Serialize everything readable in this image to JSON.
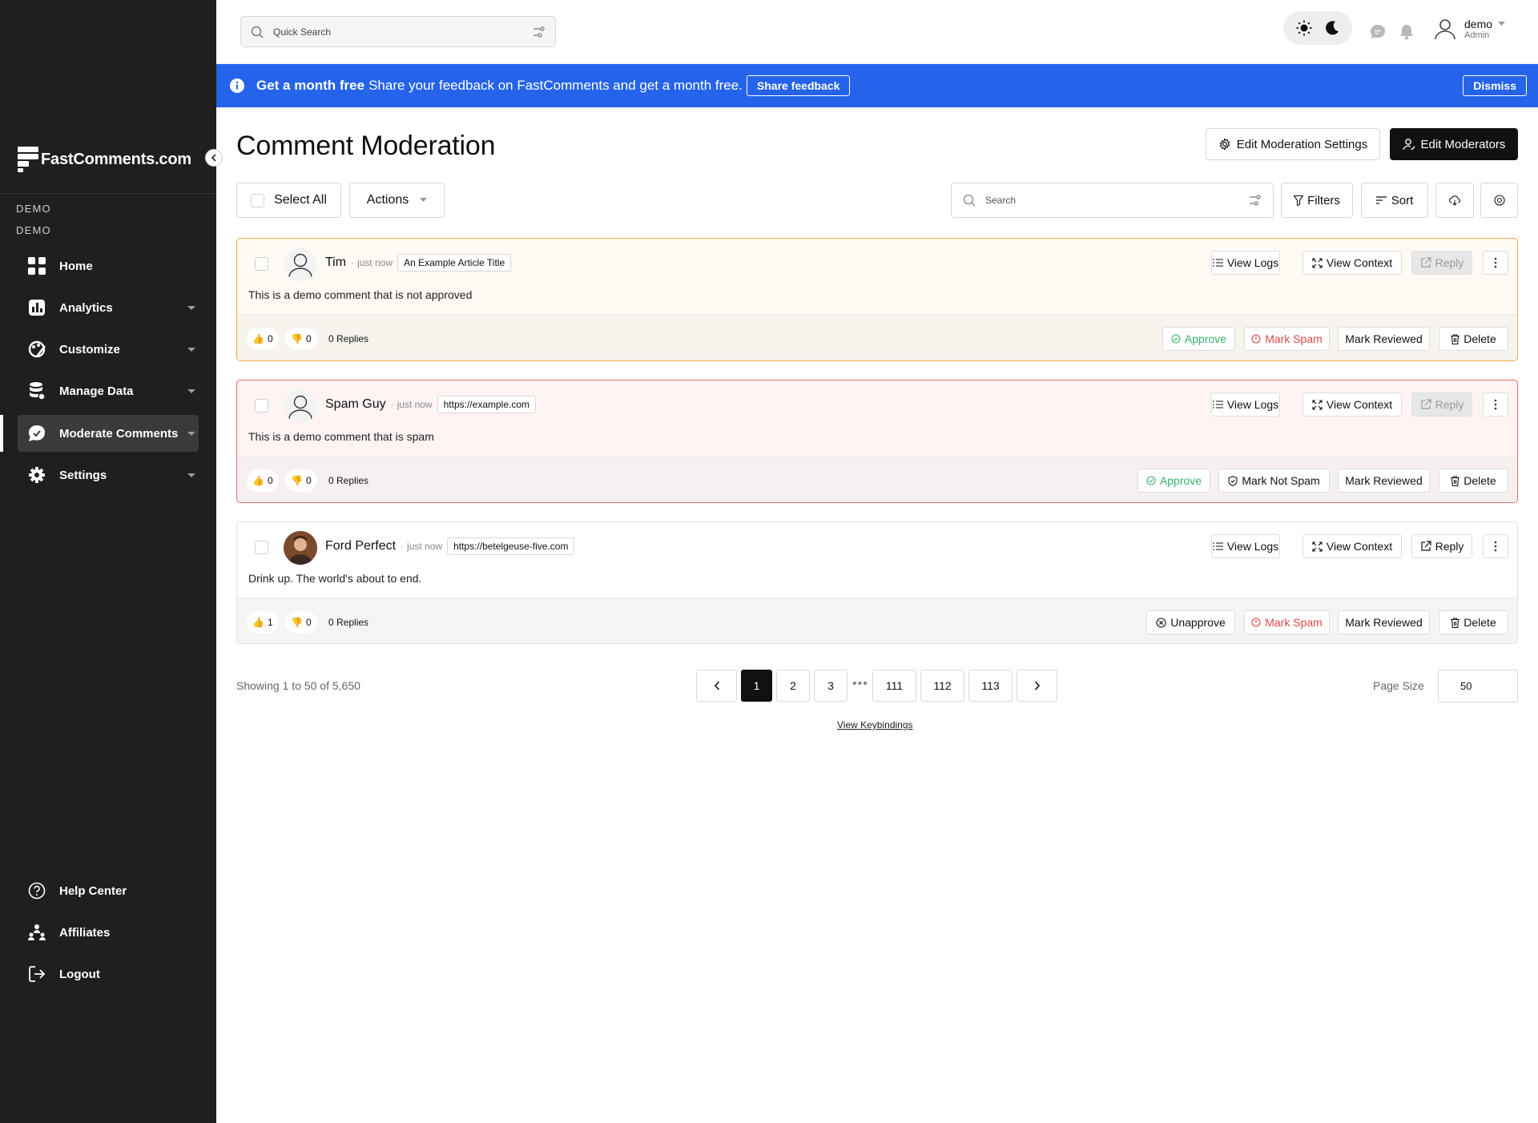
{
  "sidebar": {
    "brand": "FastComments.com",
    "org_line1": "DEMO",
    "org_line2": "DEMO",
    "items": [
      {
        "label": "Home",
        "icon": "grid-icon",
        "has_caret": false
      },
      {
        "label": "Analytics",
        "icon": "chart-icon",
        "has_caret": true
      },
      {
        "label": "Customize",
        "icon": "palette-icon",
        "has_caret": true
      },
      {
        "label": "Manage Data",
        "icon": "database-icon",
        "has_caret": true
      },
      {
        "label": "Moderate Comments",
        "icon": "chat-icon",
        "has_caret": true,
        "active": true
      },
      {
        "label": "Settings",
        "icon": "gear-icon",
        "has_caret": true
      }
    ],
    "bottom_items": [
      {
        "label": "Help Center",
        "icon": "help-circle-icon"
      },
      {
        "label": "Affiliates",
        "icon": "people-icon"
      },
      {
        "label": "Logout",
        "icon": "logout-icon"
      }
    ]
  },
  "topbar": {
    "search_placeholder": "Quick Search",
    "user_name": "demo",
    "user_role": "Admin"
  },
  "banner": {
    "bold": "Get a month free",
    "message": "Share your feedback on FastComments and get a month free.",
    "share_label": "Share feedback",
    "dismiss_label": "Dismiss",
    "color": "#2563eb"
  },
  "page": {
    "title": "Comment Moderation",
    "edit_settings_label": "Edit Moderation Settings",
    "edit_moderators_label": "Edit Moderators",
    "select_all_label": "Select All",
    "actions_label": "Actions",
    "search_placeholder": "Search",
    "filters_label": "Filters",
    "sort_label": "Sort"
  },
  "comments": [
    {
      "author": "Tim",
      "time": "just now",
      "page": "An Example Article Title",
      "text": "This is a demo comment that is not approved",
      "upvotes": "0",
      "downvotes": "0",
      "replies": "0 Replies",
      "status": "pending",
      "view_logs": "View Logs",
      "view_context": "View Context",
      "reply": "Reply",
      "approve": "Approve",
      "spam": "Mark Spam",
      "reviewed": "Mark Reviewed",
      "delete": "Delete"
    },
    {
      "author": "Spam Guy",
      "time": "just now",
      "page": "https://example.com",
      "text": "This is a demo comment that is spam",
      "upvotes": "0",
      "downvotes": "0",
      "replies": "0 Replies",
      "status": "spam",
      "view_logs": "View Logs",
      "view_context": "View Context",
      "reply": "Reply",
      "approve": "Approve",
      "spam": "Mark Not Spam",
      "reviewed": "Mark Reviewed",
      "delete": "Delete"
    },
    {
      "author": "Ford Perfect",
      "time": "just now",
      "page": "https://betelgeuse-five.com",
      "text": "Drink up. The world's about to end.",
      "upvotes": "1",
      "downvotes": "0",
      "replies": "0 Replies",
      "status": "approved",
      "view_logs": "View Logs",
      "view_context": "View Context",
      "reply": "Reply",
      "approve": "Unapprove",
      "spam": "Mark Spam",
      "reviewed": "Mark Reviewed",
      "delete": "Delete"
    }
  ],
  "pagination": {
    "showing": "Showing 1 to 50 of 5,650",
    "pages": [
      "1",
      "2",
      "3",
      "111",
      "112",
      "113"
    ],
    "current": "1",
    "ellipsis": "•••",
    "page_size_label": "Page Size",
    "page_size": "50",
    "keybindings_label": "View Keybindings"
  }
}
